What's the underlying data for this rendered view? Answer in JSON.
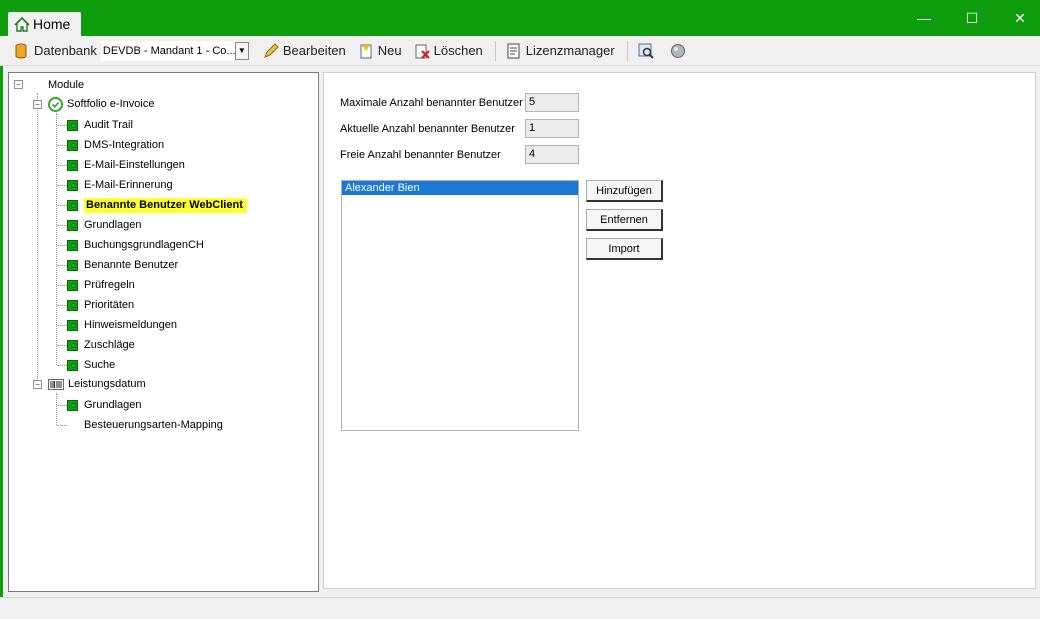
{
  "window": {
    "tab_home": "Home",
    "minimize": "—",
    "maximize": "☐",
    "close": "✕"
  },
  "toolbar": {
    "datenbank_label": "Datenbank",
    "datenbank_value": "DEVDB - Mandant 1 - Co...",
    "bearbeiten": "Bearbeiten",
    "neu": "Neu",
    "loeschen": "Löschen",
    "lizenzmanager": "Lizenzmanager"
  },
  "tree": {
    "root": "Module",
    "einvoice": {
      "label": "Softfolio e-Invoice",
      "children": [
        "Audit Trail",
        "DMS-Integration",
        "E-Mail-Einstellungen",
        "E-Mail-Erinnerung",
        "Benannte Benutzer WebClient",
        "Grundlagen",
        "BuchungsgrundlagenCH",
        "Benannte Benutzer",
        "Prüfregeln",
        "Prioritäten",
        "Hinweismeldungen",
        "Zuschläge",
        "Suche"
      ]
    },
    "leistungsdatum": {
      "label": "Leistungsdatum",
      "children": [
        "Grundlagen",
        "Besteuerungsarten-Mapping"
      ]
    }
  },
  "form": {
    "max_label": "Maximale Anzahl benannter Benutzer",
    "max_value": "5",
    "current_label": "Aktuelle Anzahl benannter Benutzer",
    "current_value": "1",
    "free_label": "Freie Anzahl benannter Benutzer",
    "free_value": "4",
    "users": [
      "Alexander Bien"
    ],
    "btn_add": "Hinzufügen",
    "btn_remove": "Entfernen",
    "btn_import": "Import"
  },
  "colors": {
    "accent": "#0d9d0d",
    "selection": "#1a78d6",
    "highlight": "#ffff2e"
  }
}
